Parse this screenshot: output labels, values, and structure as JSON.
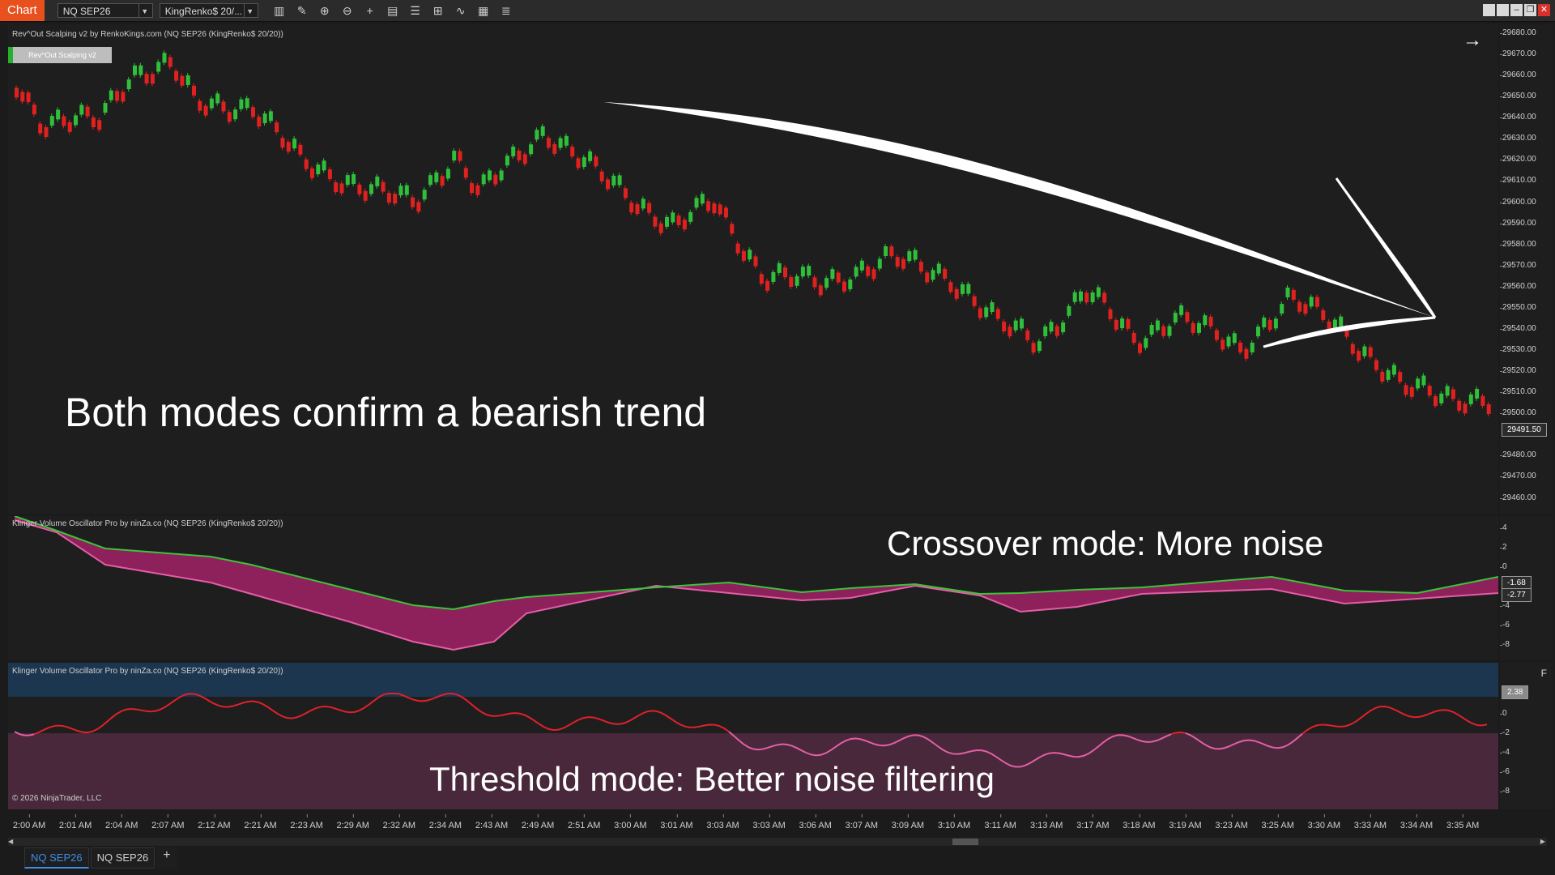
{
  "toolbar": {
    "chart_tab": "Chart",
    "instrument": "NQ SEP26",
    "bar_type": "KingRenko$ 20/...",
    "icons": [
      "bars-icon",
      "pencil-icon",
      "zoom-in-icon",
      "zoom-out-icon",
      "crosshair-icon",
      "properties-icon",
      "template-icon",
      "strategy-icon",
      "indicator-icon",
      "calculator-icon",
      "list-icon"
    ],
    "window_buttons": [
      "tile",
      "tile",
      "minimize",
      "restore",
      "close"
    ]
  },
  "price_panel": {
    "label": "Rev^Out Scalping v2 by RenkoKings.com (NQ SEP26 (KingRenko$ 20/20))",
    "indicator_button": "Rev^Out Scalping v2",
    "annotation": "Both modes confirm a bearish trend",
    "axis_ticks": [
      "29680.00",
      "29670.00",
      "29660.00",
      "29650.00",
      "29640.00",
      "29630.00",
      "29620.00",
      "29610.00",
      "29600.00",
      "29590.00",
      "29580.00",
      "29570.00",
      "29560.00",
      "29550.00",
      "29540.00",
      "29530.00",
      "29520.00",
      "29510.00",
      "29500.00",
      "29480.00",
      "29470.00",
      "29460.00"
    ],
    "last_price": "29491.50"
  },
  "osc1_panel": {
    "label": "Klinger Volume Oscillator Pro by ninZa.co (NQ SEP26 (KingRenko$ 20/20))",
    "annotation": "Crossover mode: More noise",
    "axis_ticks": [
      "4",
      "2",
      "0",
      "-4",
      "-6",
      "-8"
    ],
    "value1": "-1.68",
    "value2": "-2.77"
  },
  "osc2_panel": {
    "label": "Klinger Volume Oscillator Pro by ninZa.co (NQ SEP26 (KingRenko$ 20/20))",
    "annotation": "Threshold mode: Better noise filtering",
    "copyright": "© 2026 NinjaTrader, LLC",
    "axis_ticks": [
      "0",
      "-2",
      "-4",
      "-6",
      "-8"
    ],
    "value": "2.38",
    "f_button": "F"
  },
  "time_axis": [
    "2:00 AM",
    "2:01 AM",
    "2:04 AM",
    "2:07 AM",
    "2:12 AM",
    "2:21 AM",
    "2:23 AM",
    "2:29 AM",
    "2:32 AM",
    "2:34 AM",
    "2:43 AM",
    "2:49 AM",
    "2:51 AM",
    "3:00 AM",
    "3:01 AM",
    "3:03 AM",
    "3:03 AM",
    "3:06 AM",
    "3:07 AM",
    "3:09 AM",
    "3:10 AM",
    "3:11 AM",
    "3:13 AM",
    "3:17 AM",
    "3:18 AM",
    "3:19 AM",
    "3:23 AM",
    "3:25 AM",
    "3:30 AM",
    "3:33 AM",
    "3:34 AM",
    "3:35 AM"
  ],
  "bottom_tabs": [
    "NQ SEP26",
    "NQ SEP26"
  ],
  "add_tab": "+",
  "colors": {
    "accent": "#e8501e",
    "up": "#2fbf3a",
    "down": "#e0211f",
    "bear_fill": "#9a2062",
    "bull_fill": "#1f5a8c",
    "pink_line": "#e45ea6",
    "green_line": "#3bc43b",
    "red_line": "#e0212a",
    "band_top": "#1c3650",
    "band_bottom": "#48283a"
  }
}
